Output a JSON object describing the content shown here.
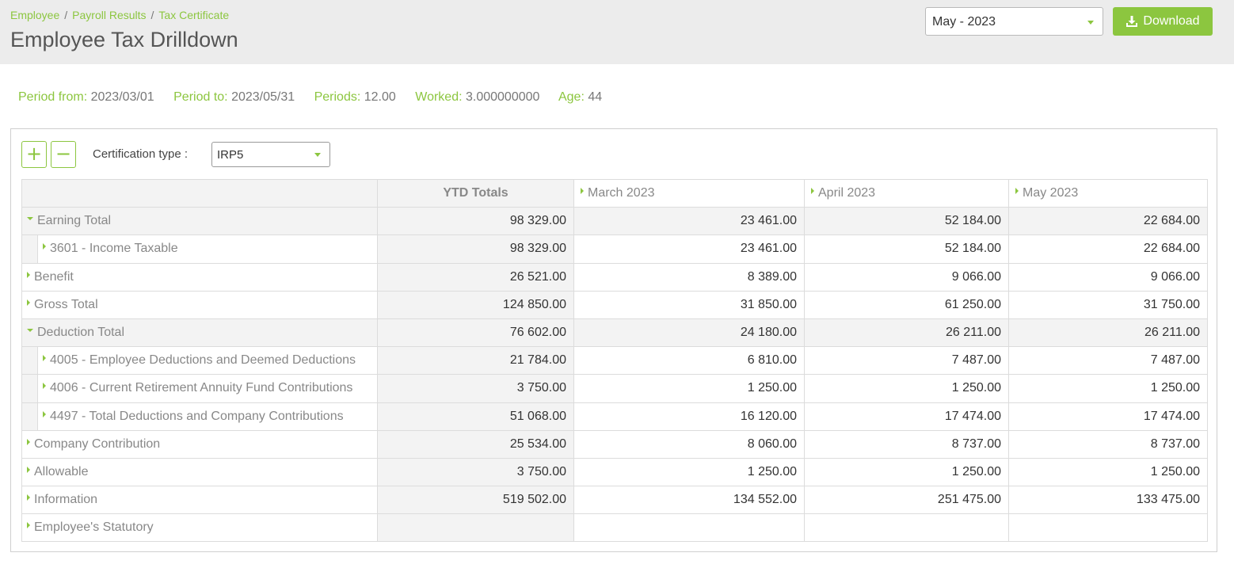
{
  "breadcrumb": {
    "items": [
      "Employee",
      "Payroll Results",
      "Tax Certificate"
    ],
    "separator": "/"
  },
  "page_title": "Employee Tax Drilldown",
  "period_select": {
    "value": "May - 2023"
  },
  "download_button": {
    "label": "Download",
    "icon": "download-icon"
  },
  "info": {
    "period_from": {
      "label": "Period from:",
      "value": "2023/03/01"
    },
    "period_to": {
      "label": "Period to:",
      "value": "2023/05/31"
    },
    "periods": {
      "label": "Periods:",
      "value": "12.00"
    },
    "worked": {
      "label": "Worked:",
      "value": "3.000000000"
    },
    "age": {
      "label": "Age:",
      "value": "44"
    }
  },
  "toolbar": {
    "expand_label": "+",
    "collapse_label": "−",
    "cert_label": "Certification type :",
    "cert_value": "IRP5"
  },
  "grid": {
    "columns": [
      {
        "label": "YTD Totals"
      },
      {
        "label": "March 2023"
      },
      {
        "label": "April 2023"
      },
      {
        "label": "May 2023"
      }
    ],
    "rows": [
      {
        "label": "Earning Total",
        "level": 0,
        "state": "expanded",
        "values": [
          "98 329.00",
          "23 461.00",
          "52 184.00",
          "22 684.00"
        ]
      },
      {
        "label": "3601 - Income Taxable",
        "level": 1,
        "state": "collapsed",
        "values": [
          "98 329.00",
          "23 461.00",
          "52 184.00",
          "22 684.00"
        ]
      },
      {
        "label": "Benefit",
        "level": 0,
        "state": "collapsed",
        "values": [
          "26 521.00",
          "8 389.00",
          "9 066.00",
          "9 066.00"
        ]
      },
      {
        "label": "Gross Total",
        "level": 0,
        "state": "collapsed",
        "values": [
          "124 850.00",
          "31 850.00",
          "61 250.00",
          "31 750.00"
        ]
      },
      {
        "label": "Deduction Total",
        "level": 0,
        "state": "expanded",
        "values": [
          "76 602.00",
          "24 180.00",
          "26 211.00",
          "26 211.00"
        ]
      },
      {
        "label": "4005 - Employee Deductions and Deemed Deductions",
        "level": 1,
        "state": "collapsed",
        "values": [
          "21 784.00",
          "6 810.00",
          "7 487.00",
          "7 487.00"
        ]
      },
      {
        "label": "4006 - Current Retirement Annuity Fund Contributions",
        "level": 1,
        "state": "collapsed",
        "values": [
          "3 750.00",
          "1 250.00",
          "1 250.00",
          "1 250.00"
        ]
      },
      {
        "label": "4497 - Total Deductions and Company Contributions",
        "level": 1,
        "state": "collapsed",
        "values": [
          "51 068.00",
          "16 120.00",
          "17 474.00",
          "17 474.00"
        ]
      },
      {
        "label": "Company Contribution",
        "level": 0,
        "state": "collapsed",
        "values": [
          "25 534.00",
          "8 060.00",
          "8 737.00",
          "8 737.00"
        ]
      },
      {
        "label": "Allowable",
        "level": 0,
        "state": "collapsed",
        "values": [
          "3 750.00",
          "1 250.00",
          "1 250.00",
          "1 250.00"
        ]
      },
      {
        "label": "Information",
        "level": 0,
        "state": "collapsed",
        "values": [
          "519 502.00",
          "134 552.00",
          "251 475.00",
          "133 475.00"
        ]
      },
      {
        "label": "Employee's Statutory",
        "level": 0,
        "state": "collapsed",
        "values": [
          "",
          "",
          "",
          ""
        ]
      }
    ]
  },
  "colors": {
    "accent": "#8cc63f",
    "header_bg": "#ececec",
    "ytd_bg": "#f3f3f3"
  }
}
